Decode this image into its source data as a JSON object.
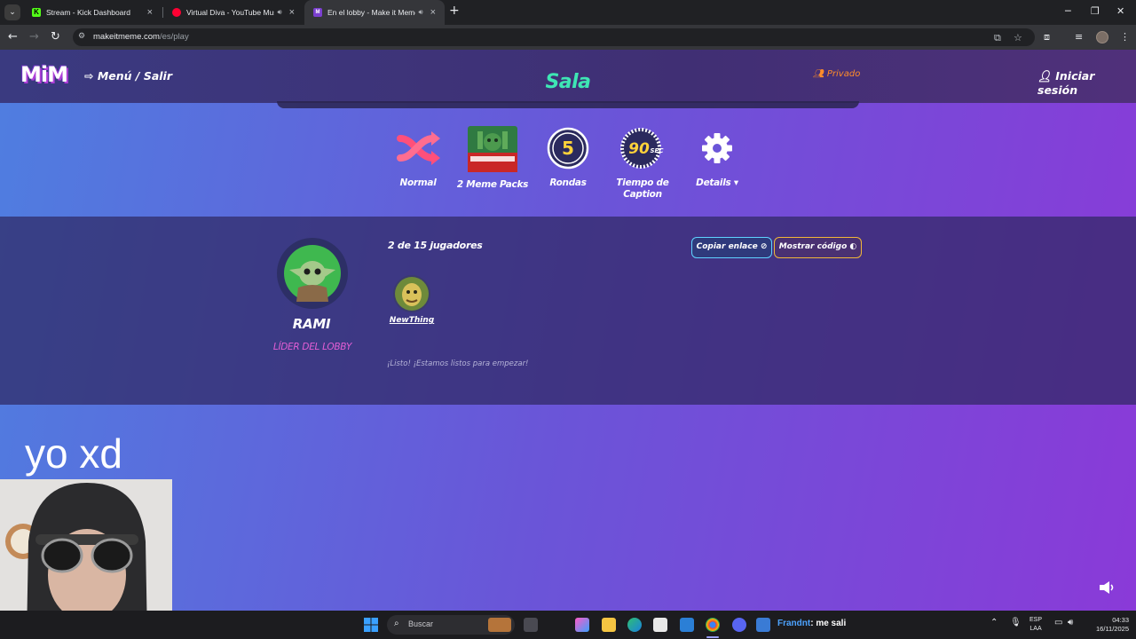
{
  "browser": {
    "tabs": [
      {
        "title": "Stream - Kick Dashboard",
        "favicon": "kick-icon",
        "color": "#53fc18",
        "audio": false,
        "active": false
      },
      {
        "title": "Virtual Diva - YouTube Music",
        "favicon": "youtube-music-icon",
        "color": "#ff0033",
        "audio": true,
        "active": false
      },
      {
        "title": "En el lobby - Make it Meme",
        "favicon": "mim-icon",
        "color": "#b45cf0",
        "audio": true,
        "active": true
      }
    ],
    "url_host": "makeitmeme.com",
    "url_path": "/es/play"
  },
  "site": {
    "logo": "MiM",
    "menu_link": "Menú / Salir",
    "room_title": "Sala",
    "privacy": "Privado",
    "login": "Iniciar sesión",
    "accent": "#3ee6b4"
  },
  "settings": [
    {
      "label": "Normal",
      "icon": "shuffle-icon"
    },
    {
      "label": "2 Meme Packs",
      "icon": "meme-pack-icon"
    },
    {
      "label": "Rondas",
      "icon": "rounds-icon",
      "value": "5"
    },
    {
      "label": "Tiempo de Caption",
      "icon": "timer-icon",
      "value": "90",
      "unit": "SEC"
    },
    {
      "label": "Details",
      "icon": "gear-icon"
    }
  ],
  "lobby": {
    "leader_name": "RAMI",
    "leader_role": "LÍDER DEL LOBBY",
    "players_current": "2",
    "players_sep": "de",
    "players_max": "15 jugadores",
    "player2_name": "NewThing",
    "ready_text": "¡Listo! ¡Estamos listos para empezar!",
    "copy_link": "Copiar enlace",
    "show_code": "Mostrar código"
  },
  "stream_overlay": {
    "text": "yo xd"
  },
  "taskbar": {
    "search_placeholder": "Buscar",
    "notification_user": "Frandnt",
    "notification_msg": ": me sali",
    "lang_1": "ESP",
    "lang_2": "LAA",
    "time": "04:33",
    "date": "16/11/2025"
  }
}
